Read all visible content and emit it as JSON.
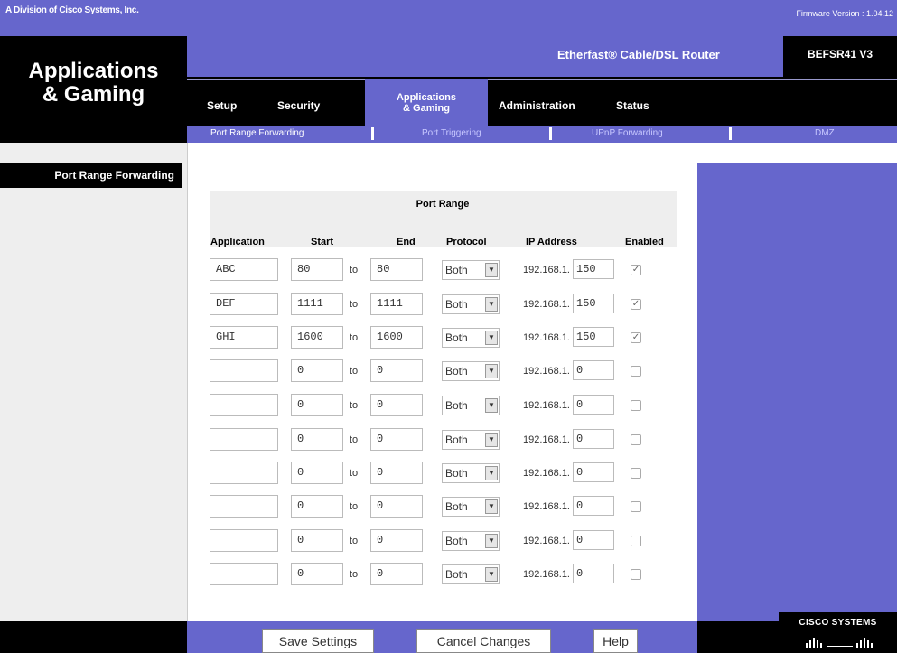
{
  "header": {
    "division": "A Division of Cisco Systems, Inc.",
    "firmware": "Firmware Version : 1.04.12",
    "title_line1": "Applications",
    "title_line2": "& Gaming",
    "product": "Etherfast® Cable/DSL Router",
    "model": "BEFSR41 V3"
  },
  "tabs": [
    {
      "label": "Setup"
    },
    {
      "label": "Security"
    },
    {
      "label_line1": "Applications",
      "label_line2": "& Gaming",
      "active": true
    },
    {
      "label": "Administration"
    },
    {
      "label": "Status"
    }
  ],
  "subtabs": [
    {
      "label": "Port Range Forwarding",
      "active": true
    },
    {
      "label": "Port Triggering"
    },
    {
      "label": "UPnP Forwarding"
    },
    {
      "label": "DMZ"
    }
  ],
  "sidebar": {
    "section_label": "Port Range Forwarding"
  },
  "table": {
    "group_header": "Port Range",
    "columns": [
      "Application",
      "Start",
      "End",
      "Protocol",
      "IP Address",
      "Enabled"
    ],
    "to_label": "to",
    "ip_prefix": "192.168.1.",
    "rows": [
      {
        "application": "ABC",
        "start": "80",
        "end": "80",
        "protocol": "Both",
        "ip_last": "150",
        "enabled": true
      },
      {
        "application": "DEF",
        "start": "1111",
        "end": "1111",
        "protocol": "Both",
        "ip_last": "150",
        "enabled": true
      },
      {
        "application": "GHI",
        "start": "1600",
        "end": "1600",
        "protocol": "Both",
        "ip_last": "150",
        "enabled": true
      },
      {
        "application": "",
        "start": "0",
        "end": "0",
        "protocol": "Both",
        "ip_last": "0",
        "enabled": false
      },
      {
        "application": "",
        "start": "0",
        "end": "0",
        "protocol": "Both",
        "ip_last": "0",
        "enabled": false
      },
      {
        "application": "",
        "start": "0",
        "end": "0",
        "protocol": "Both",
        "ip_last": "0",
        "enabled": false
      },
      {
        "application": "",
        "start": "0",
        "end": "0",
        "protocol": "Both",
        "ip_last": "0",
        "enabled": false
      },
      {
        "application": "",
        "start": "0",
        "end": "0",
        "protocol": "Both",
        "ip_last": "0",
        "enabled": false
      },
      {
        "application": "",
        "start": "0",
        "end": "0",
        "protocol": "Both",
        "ip_last": "0",
        "enabled": false
      },
      {
        "application": "",
        "start": "0",
        "end": "0",
        "protocol": "Both",
        "ip_last": "0",
        "enabled": false
      }
    ]
  },
  "buttons": {
    "save": "Save Settings",
    "cancel": "Cancel Changes",
    "help": "Help"
  },
  "brand": {
    "cisco": "CISCO SYSTEMS"
  },
  "colors": {
    "accent": "#6666cc",
    "dark": "#000000",
    "panel": "#eeeeee"
  }
}
